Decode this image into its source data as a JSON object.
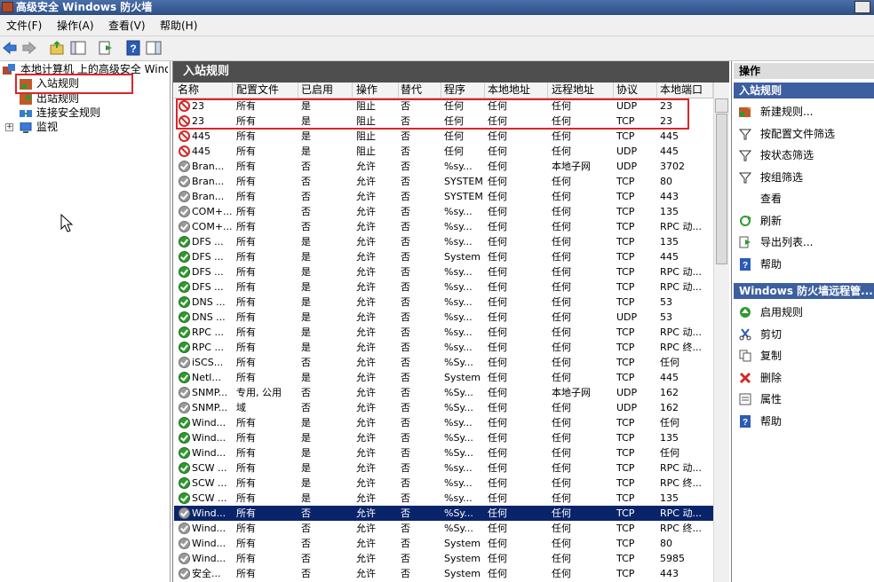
{
  "window": {
    "title": "高级安全 Windows 防火墙"
  },
  "menu": [
    "文件(F)",
    "操作(A)",
    "查看(V)",
    "帮助(H)"
  ],
  "tree": {
    "root": "本地计算机 上的高级安全 Wind",
    "inbound": "入站规则",
    "outbound": "出站规则",
    "connection": "连接安全规则",
    "monitor": "监视"
  },
  "center": {
    "title": "入站规则",
    "columns": [
      "名称",
      "配置文件",
      "已启用",
      "操作",
      "替代",
      "程序",
      "本地地址",
      "远程地址",
      "协议",
      "本地端口"
    ],
    "rows": [
      {
        "icon": "block",
        "c": [
          "23",
          "所有",
          "是",
          "阻止",
          "否",
          "任何",
          "任何",
          "任何",
          "UDP",
          "23"
        ]
      },
      {
        "icon": "block",
        "c": [
          "23",
          "所有",
          "是",
          "阻止",
          "否",
          "任何",
          "任何",
          "任何",
          "TCP",
          "23"
        ]
      },
      {
        "icon": "block",
        "c": [
          "445",
          "所有",
          "是",
          "阻止",
          "否",
          "任何",
          "任何",
          "任何",
          "TCP",
          "445"
        ]
      },
      {
        "icon": "block",
        "c": [
          "445",
          "所有",
          "是",
          "阻止",
          "否",
          "任何",
          "任何",
          "任何",
          "UDP",
          "445"
        ]
      },
      {
        "icon": "off",
        "c": [
          "Bran...",
          "所有",
          "否",
          "允许",
          "否",
          "%sy...",
          "任何",
          "本地子网",
          "UDP",
          "3702"
        ]
      },
      {
        "icon": "off",
        "c": [
          "Bran...",
          "所有",
          "否",
          "允许",
          "否",
          "SYSTEM",
          "任何",
          "任何",
          "TCP",
          "80"
        ]
      },
      {
        "icon": "off",
        "c": [
          "Bran...",
          "所有",
          "否",
          "允许",
          "否",
          "SYSTEM",
          "任何",
          "任何",
          "TCP",
          "443"
        ]
      },
      {
        "icon": "off",
        "c": [
          "COM+...",
          "所有",
          "否",
          "允许",
          "否",
          "%sy...",
          "任何",
          "任何",
          "TCP",
          "135"
        ]
      },
      {
        "icon": "off",
        "c": [
          "COM+...",
          "所有",
          "否",
          "允许",
          "否",
          "%sy...",
          "任何",
          "任何",
          "TCP",
          "RPC 动..."
        ]
      },
      {
        "icon": "allow",
        "c": [
          "DFS ...",
          "所有",
          "是",
          "允许",
          "否",
          "%sy...",
          "任何",
          "任何",
          "TCP",
          "135"
        ]
      },
      {
        "icon": "allow",
        "c": [
          "DFS ...",
          "所有",
          "是",
          "允许",
          "否",
          "System",
          "任何",
          "任何",
          "TCP",
          "445"
        ]
      },
      {
        "icon": "allow",
        "c": [
          "DFS ...",
          "所有",
          "是",
          "允许",
          "否",
          "%sy...",
          "任何",
          "任何",
          "TCP",
          "RPC 动..."
        ]
      },
      {
        "icon": "allow",
        "c": [
          "DFS ...",
          "所有",
          "是",
          "允许",
          "否",
          "%sy...",
          "任何",
          "任何",
          "TCP",
          "RPC 动..."
        ]
      },
      {
        "icon": "allow",
        "c": [
          "DNS ...",
          "所有",
          "是",
          "允许",
          "否",
          "%sy...",
          "任何",
          "任何",
          "TCP",
          "53"
        ]
      },
      {
        "icon": "allow",
        "c": [
          "DNS ...",
          "所有",
          "是",
          "允许",
          "否",
          "%sy...",
          "任何",
          "任何",
          "UDP",
          "53"
        ]
      },
      {
        "icon": "allow",
        "c": [
          "RPC ...",
          "所有",
          "是",
          "允许",
          "否",
          "%sy...",
          "任何",
          "任何",
          "TCP",
          "RPC 动..."
        ]
      },
      {
        "icon": "allow",
        "c": [
          "RPC ...",
          "所有",
          "是",
          "允许",
          "否",
          "%sy...",
          "任何",
          "任何",
          "TCP",
          "RPC 终..."
        ]
      },
      {
        "icon": "off",
        "c": [
          "iSCS...",
          "所有",
          "否",
          "允许",
          "否",
          "%Sy...",
          "任何",
          "任何",
          "TCP",
          "任何"
        ]
      },
      {
        "icon": "allow",
        "c": [
          "Netl...",
          "所有",
          "是",
          "允许",
          "否",
          "System",
          "任何",
          "任何",
          "TCP",
          "445"
        ]
      },
      {
        "icon": "off",
        "c": [
          "SNMP...",
          "专用, 公用",
          "否",
          "允许",
          "否",
          "%Sy...",
          "任何",
          "本地子网",
          "UDP",
          "162"
        ]
      },
      {
        "icon": "off",
        "c": [
          "SNMP...",
          "域",
          "否",
          "允许",
          "否",
          "%Sy...",
          "任何",
          "任何",
          "UDP",
          "162"
        ]
      },
      {
        "icon": "allow",
        "c": [
          "Wind...",
          "所有",
          "是",
          "允许",
          "否",
          "%sy...",
          "任何",
          "任何",
          "TCP",
          "任何"
        ]
      },
      {
        "icon": "allow",
        "c": [
          "Wind...",
          "所有",
          "是",
          "允许",
          "否",
          "%Sy...",
          "任何",
          "任何",
          "TCP",
          "135"
        ]
      },
      {
        "icon": "allow",
        "c": [
          "Wind...",
          "所有",
          "是",
          "允许",
          "否",
          "%Sy...",
          "任何",
          "任何",
          "TCP",
          "任何"
        ]
      },
      {
        "icon": "allow",
        "c": [
          "SCW ...",
          "所有",
          "是",
          "允许",
          "否",
          "%sy...",
          "任何",
          "任何",
          "TCP",
          "RPC 动..."
        ]
      },
      {
        "icon": "allow",
        "c": [
          "SCW ...",
          "所有",
          "是",
          "允许",
          "否",
          "%sy...",
          "任何",
          "任何",
          "TCP",
          "RPC 终..."
        ]
      },
      {
        "icon": "allow",
        "c": [
          "SCW ...",
          "所有",
          "是",
          "允许",
          "否",
          "%sy...",
          "任何",
          "任何",
          "TCP",
          "135"
        ]
      },
      {
        "icon": "off",
        "sel": true,
        "c": [
          "Wind...",
          "所有",
          "否",
          "允许",
          "否",
          "%Sy...",
          "任何",
          "任何",
          "TCP",
          "RPC 动..."
        ]
      },
      {
        "icon": "off",
        "c": [
          "Wind...",
          "所有",
          "否",
          "允许",
          "否",
          "%Sy...",
          "任何",
          "任何",
          "TCP",
          "RPC 终..."
        ]
      },
      {
        "icon": "off",
        "c": [
          "Wind...",
          "所有",
          "否",
          "允许",
          "否",
          "System",
          "任何",
          "任何",
          "TCP",
          "80"
        ]
      },
      {
        "icon": "off",
        "c": [
          "Wind...",
          "所有",
          "否",
          "允许",
          "否",
          "System",
          "任何",
          "任何",
          "TCP",
          "5985"
        ]
      },
      {
        "icon": "off",
        "c": [
          "安全...",
          "所有",
          "否",
          "允许",
          "否",
          "System",
          "任何",
          "任何",
          "TCP",
          "443"
        ]
      }
    ]
  },
  "actions": {
    "header": "操作",
    "section1": "入站规则",
    "items1": [
      {
        "label": "新建规则...",
        "icon": "new-rule-icon"
      },
      {
        "label": "按配置文件筛选",
        "icon": "filter-icon"
      },
      {
        "label": "按状态筛选",
        "icon": "filter-icon"
      },
      {
        "label": "按组筛选",
        "icon": "filter-icon"
      },
      {
        "label": "查看",
        "icon": "view-icon"
      },
      {
        "label": "刷新",
        "icon": "refresh-icon"
      },
      {
        "label": "导出列表...",
        "icon": "export-icon"
      },
      {
        "label": "帮助",
        "icon": "help-icon"
      }
    ],
    "section2": "Windows 防火墙远程管...",
    "items2": [
      {
        "label": "启用规则",
        "icon": "enable-icon"
      },
      {
        "label": "剪切",
        "icon": "cut-icon"
      },
      {
        "label": "复制",
        "icon": "copy-icon"
      },
      {
        "label": "删除",
        "icon": "delete-icon"
      },
      {
        "label": "属性",
        "icon": "properties-icon"
      },
      {
        "label": "帮助",
        "icon": "help-icon"
      }
    ]
  }
}
